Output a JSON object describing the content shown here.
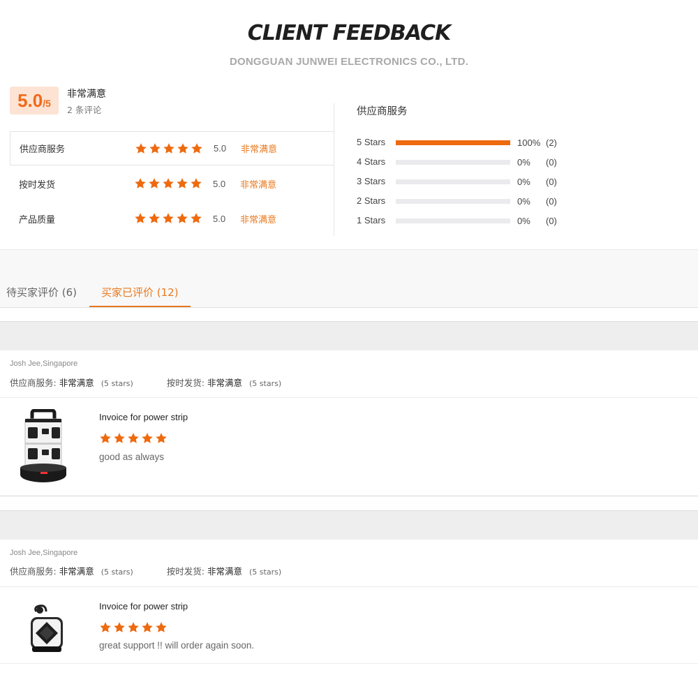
{
  "header": {
    "title": "CLIENT FEEDBACK",
    "subtitle": "DONGGUAN JUNWEI ELECTRONICS CO., LTD."
  },
  "summary": {
    "score": "5.0",
    "score_max": "/5",
    "overall_label": "非常满意",
    "review_count": "2 条评论",
    "rating_star_count": 5,
    "categories": [
      {
        "label": "供应商服务",
        "stars": 5,
        "score": "5.0",
        "text": "非常满意"
      },
      {
        "label": "按时发货",
        "stars": 5,
        "score": "5.0",
        "text": "非常满意"
      },
      {
        "label": "产品质量",
        "stars": 5,
        "score": "5.0",
        "text": "非常满意"
      }
    ],
    "distribution_title": "供应商服务",
    "distribution": [
      {
        "label": "5  Stars",
        "fraction": 1.0,
        "pct": "100%",
        "count": "(2)"
      },
      {
        "label": "4  Stars",
        "fraction": 0.0,
        "pct": "0%",
        "count": "(0)"
      },
      {
        "label": "3  Stars",
        "fraction": 0.0,
        "pct": "0%",
        "count": "(0)"
      },
      {
        "label": "2  Stars",
        "fraction": 0.0,
        "pct": "0%",
        "count": "(0)"
      },
      {
        "label": "1  Stars",
        "fraction": 0.0,
        "pct": "0%",
        "count": "(0)"
      }
    ]
  },
  "tabs": [
    {
      "label": "待买家评价 (6)",
      "active": false
    },
    {
      "label": "买家已评价 (12)",
      "active": true
    }
  ],
  "reviews": [
    {
      "user": "Josh Jee,Singapore",
      "service_label": "供应商服务:",
      "service_value": "非常满意",
      "service_stars": "(5 stars)",
      "delivery_label": "按时发货:",
      "delivery_value": "非常满意",
      "delivery_stars": "(5 stars)",
      "product_title": "Invoice for power strip",
      "stars": 5,
      "comment": "good as always",
      "image_icon": "power-tower-icon"
    },
    {
      "user": "Josh Jee,Singapore",
      "service_label": "供应商服务:",
      "service_value": "非常满意",
      "service_stars": "(5 stars)",
      "delivery_label": "按时发货:",
      "delivery_value": "非常满意",
      "delivery_stars": "(5 stars)",
      "product_title": "Invoice for power strip",
      "stars": 5,
      "comment": "great support !! will order again soon.",
      "image_icon": "power-cube-icon"
    }
  ],
  "colors": {
    "accent": "#ee6a0f",
    "accent_text": "#e8791f",
    "score_bg": "#fde3d3"
  }
}
